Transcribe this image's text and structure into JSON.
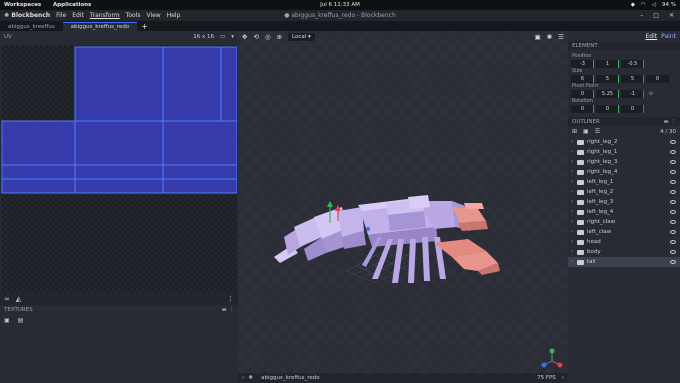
{
  "system_bar": {
    "workspaces": "Workspaces",
    "applications": "Applications",
    "datetime": "Jul 6  11:33 AM",
    "battery": "94 %"
  },
  "menubar": {
    "app_name": "Blockbench",
    "menus": [
      "File",
      "Edit",
      "Transform",
      "Tools",
      "View",
      "Help"
    ],
    "window_title": "● abiggus_kreffus_redo - Blockbench"
  },
  "tabs": [
    {
      "label": "abiggus_kreeffus",
      "active": false
    },
    {
      "label": "abiggus_kreffus_redo",
      "active": true
    }
  ],
  "tab_add": "+",
  "uv_panel": {
    "title": "UV",
    "size": "16 x 16",
    "fields": [
      "0",
      "0"
    ]
  },
  "textures_panel": {
    "title": "TEXTURES"
  },
  "viewport": {
    "space_select": "Local",
    "model_name": "abiggus_kreffus_redo",
    "fps": "75 FPS"
  },
  "right_panel": {
    "mode_edit": "Edit",
    "mode_paint": "Paint",
    "element_title": "ELEMENT",
    "position_label": "Position",
    "position": [
      "-3",
      "1",
      "-0.5"
    ],
    "size_label": "Size",
    "size": [
      "6",
      "5",
      "5",
      "0"
    ],
    "pivot_label": "Pivot Point",
    "pivot": [
      "0",
      "5.25",
      "-1"
    ],
    "rotation_label": "Rotation",
    "rotation": [
      "0",
      "0",
      "0"
    ],
    "outliner_title": "OUTLINER",
    "outliner_count": "4 / 30",
    "outliner_items": [
      {
        "name": "right_leg_2",
        "selected": false
      },
      {
        "name": "right_leg_1",
        "selected": false
      },
      {
        "name": "right_leg_3",
        "selected": false
      },
      {
        "name": "right_leg_4",
        "selected": false
      },
      {
        "name": "left_leg_1",
        "selected": false
      },
      {
        "name": "left_leg_2",
        "selected": false
      },
      {
        "name": "left_leg_3",
        "selected": false
      },
      {
        "name": "left_leg_4",
        "selected": false
      },
      {
        "name": "right_claw",
        "selected": false
      },
      {
        "name": "left_claw",
        "selected": false
      },
      {
        "name": "head",
        "selected": false
      },
      {
        "name": "body",
        "selected": false
      },
      {
        "name": "tail",
        "selected": true
      }
    ]
  },
  "colors": {
    "accent": "#3d6fff",
    "uv_fill": "#3a3fb0",
    "uv_border": "#4a7dff",
    "model_body": "#c9b6ee",
    "model_claw": "#e58a82"
  }
}
